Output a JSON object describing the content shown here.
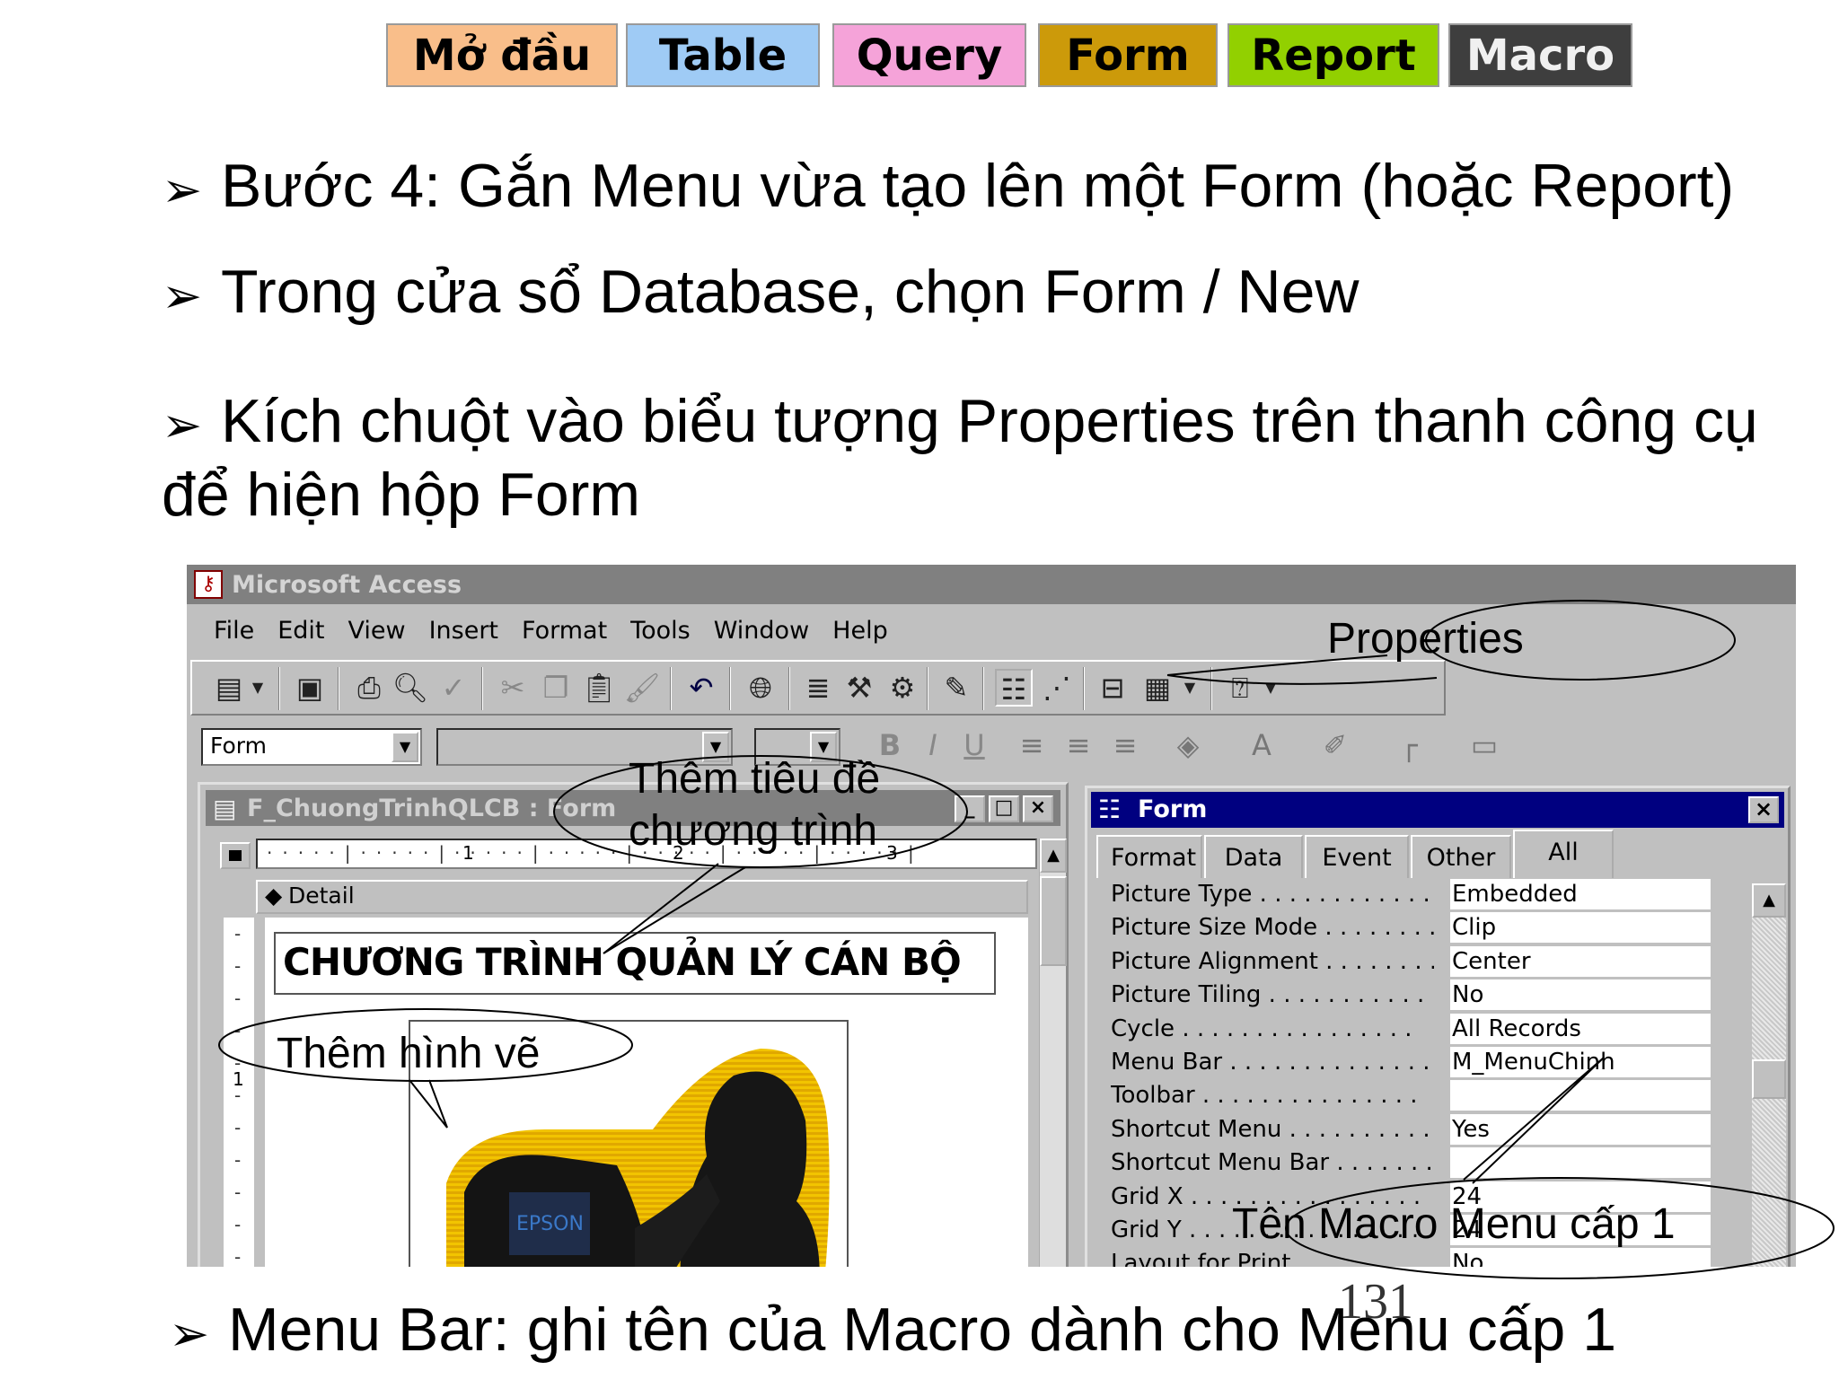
{
  "nav": {
    "tabs": [
      {
        "label": "Mở đầu",
        "color": "#f9be8a"
      },
      {
        "label": "Table",
        "color": "#9fcbf5"
      },
      {
        "label": "Query",
        "color": "#f5a3d9"
      },
      {
        "label": "Form",
        "color": "#cc9a0a"
      },
      {
        "label": "Report",
        "color": "#92d000"
      },
      {
        "label": "Macro",
        "color": "#3e3e3e"
      }
    ]
  },
  "bullets": {
    "b1": "Bước 4: Gắn Menu vừa tạo lên một Form (hoặc Report)",
    "b2": "Trong cửa sổ Database, chọn Form / New",
    "b3_line1": "Kích  chuột vào biểu tượng Properties trên thanh công cụ",
    "b3_line2": "để hiện hộp Form",
    "b4": "Menu Bar: ghi tên của Macro dành cho Menu cấp 1",
    "arrow": "➢"
  },
  "access": {
    "title": "Microsoft Access",
    "menu": [
      "File",
      "Edit",
      "View",
      "Insert",
      "Format",
      "Tools",
      "Window",
      "Help"
    ],
    "object_combo": "Form",
    "design_window": {
      "title": "F_ChuongTrinhQLCB : Form",
      "section": "Detail",
      "ruler": [
        "1",
        "2",
        "3"
      ],
      "vruler": "1",
      "title_label": "CHƯƠNG TRÌNH QUẢN LÝ CÁN BỘ",
      "picture_text": "EPSON"
    },
    "properties": {
      "title": "Form",
      "tabs": [
        "Format",
        "Data",
        "Event",
        "Other",
        "All"
      ],
      "active_tab": "All",
      "rows": [
        {
          "name": "Picture Type . . . . . . . . . . . .",
          "value": "Embedded"
        },
        {
          "name": "Picture Size Mode . . . . . . . .",
          "value": "Clip"
        },
        {
          "name": "Picture Alignment . . . . . . . .",
          "value": "Center"
        },
        {
          "name": "Picture Tiling . . . . . . . . . . . .",
          "value": "No"
        },
        {
          "name": "Cycle . . . . . . . . . . . . . . . .",
          "value": "All Records"
        },
        {
          "name": "Menu Bar . . . . . . . . . . . . . .",
          "value": "M_MenuChinh"
        },
        {
          "name": "Toolbar . . . . . . . . . . . . . . .",
          "value": ""
        },
        {
          "name": "Shortcut Menu . . . . . . . . . . .",
          "value": "Yes"
        },
        {
          "name": "Shortcut Menu Bar . . . . . . .",
          "value": ""
        },
        {
          "name": "Grid X . . . . . . . . . . . . . . . .",
          "value": "24"
        },
        {
          "name": "Grid Y . . . . . . . . . . . . . . . .",
          "value": "24"
        },
        {
          "name": "Layout for Print . . . . . . . . .",
          "value": "No"
        }
      ]
    }
  },
  "callouts": {
    "properties": "Properties",
    "title_line1": "Thêm tiêu đề",
    "title_line2": "chương trình",
    "picture": "Thêm hình vẽ",
    "macro": "Tên Macro Menu cấp 1"
  },
  "page_number": "131"
}
